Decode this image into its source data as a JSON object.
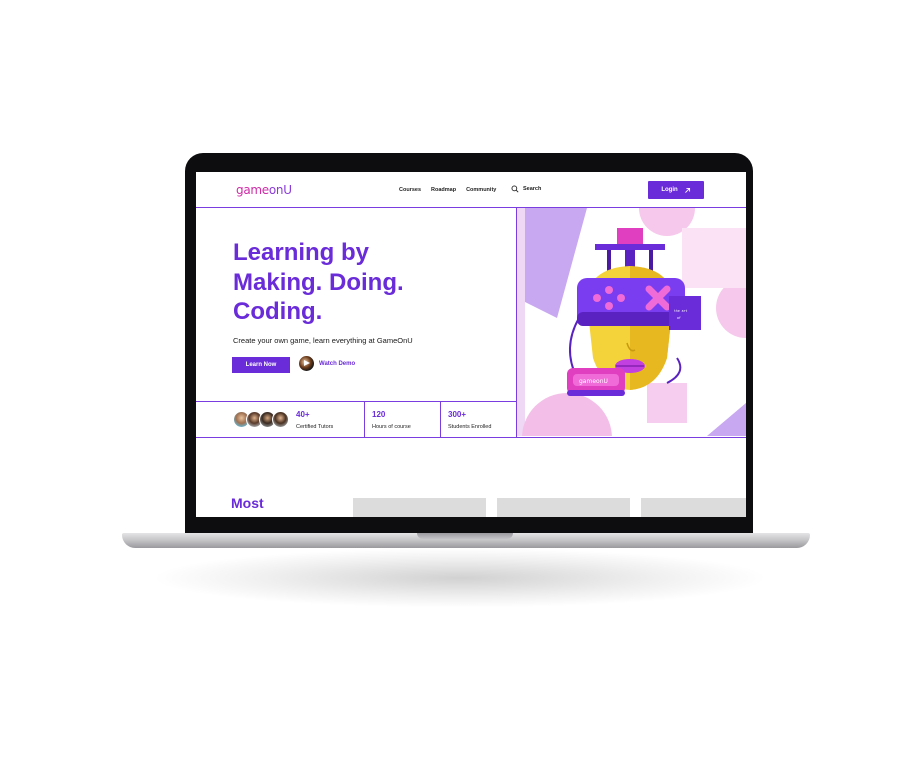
{
  "brand": {
    "logo_part1": "game",
    "logo_part2": "onU"
  },
  "nav": {
    "links": [
      "Courses",
      "Roadmap",
      "Community"
    ],
    "search_label": "Search",
    "login_label": "Login"
  },
  "hero": {
    "headline_line1": "Learning by",
    "headline_line2": "Making. Doing.",
    "headline_line3": "Coding.",
    "subtitle": "Create your own game, learn everything at GameOnU",
    "learn_button": "Learn Now",
    "demo_label": "Watch Demo"
  },
  "stats": [
    {
      "value": "40+",
      "label": "Certified Tutors"
    },
    {
      "value": "120",
      "label": "Hours of course"
    },
    {
      "value": "300+",
      "label": "Students Enrolled"
    }
  ],
  "illustration": {
    "headset_badge": "gameonU"
  },
  "section": {
    "heading": "Most"
  },
  "colors": {
    "primary": "#6a2bd9",
    "accent_pink": "#e06ad8",
    "lavender": "#c9a8f2"
  },
  "icons": [
    "search-icon",
    "arrow-up-right-icon",
    "play-icon"
  ]
}
